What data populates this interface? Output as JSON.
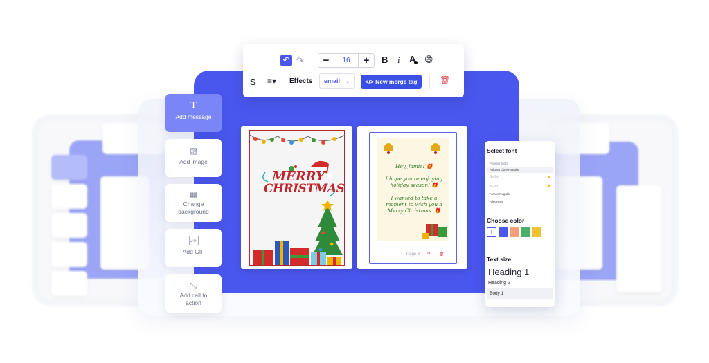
{
  "toolbar": {
    "font_size": "16",
    "decrease_label": "−",
    "increase_label": "+",
    "bold_label": "B",
    "italic_label": "i",
    "color_label": "A",
    "effects_label": "Effects",
    "select_value": "email",
    "merge_tag_label": "New merge tag",
    "merge_tag_glyph": "</>"
  },
  "tools": [
    {
      "label": "Add message",
      "icon": "text-icon"
    },
    {
      "label": "Add image",
      "icon": "image-add-icon"
    },
    {
      "label": "Change background",
      "icon": "background-icon"
    },
    {
      "label": "Add GIF",
      "icon": "gif-icon"
    },
    {
      "label": "Add call to action",
      "icon": "cursor-click-icon"
    }
  ],
  "card1": {
    "line1": "MERRY",
    "line2": "CHRISTMAS"
  },
  "card2": {
    "greeting": "Hey, Jamie! 🎁",
    "line1": "I hope you're enjoying holiday season! 🎁",
    "line2": "I wanted to take a moment to wish you a Merry Christmas. 🎁",
    "page_label": "Page 2"
  },
  "panel": {
    "select_font_title": "Select font",
    "popular_fonts_label": "Popular fonts",
    "fonts": [
      "Akkaya Libre Regular",
      "Rollie",
      "SCAR",
      "Aleron Regular",
      "Allegreya"
    ],
    "choose_color_title": "Choose color",
    "colors": [
      "#4a57ee",
      "#f0a07a",
      "#4caf68",
      "#f2c230"
    ],
    "text_size_title": "Text size",
    "heading1": "Heading 1",
    "heading2": "Heading 2",
    "body1": "Body 1"
  }
}
